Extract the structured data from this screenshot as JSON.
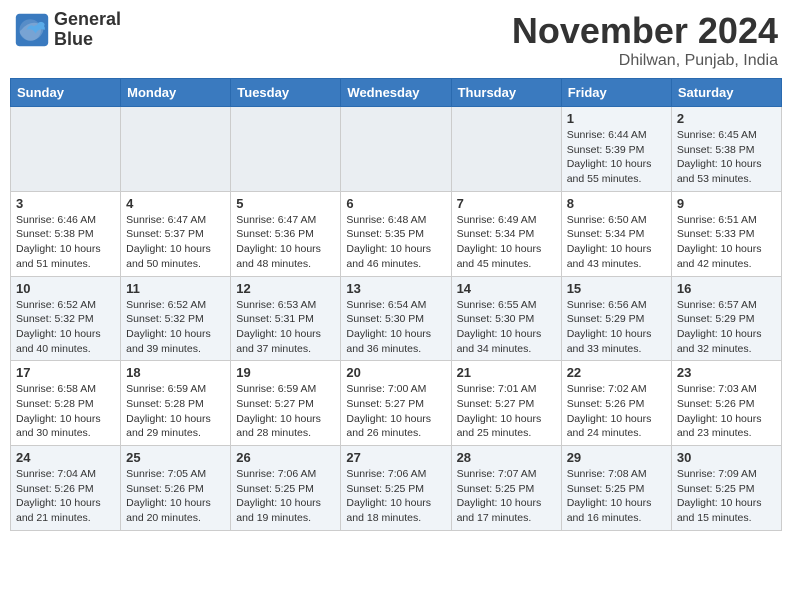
{
  "header": {
    "logo_line1": "General",
    "logo_line2": "Blue",
    "month_title": "November 2024",
    "location": "Dhilwan, Punjab, India"
  },
  "weekdays": [
    "Sunday",
    "Monday",
    "Tuesday",
    "Wednesday",
    "Thursday",
    "Friday",
    "Saturday"
  ],
  "weeks": [
    [
      {
        "day": "",
        "info": ""
      },
      {
        "day": "",
        "info": ""
      },
      {
        "day": "",
        "info": ""
      },
      {
        "day": "",
        "info": ""
      },
      {
        "day": "",
        "info": ""
      },
      {
        "day": "1",
        "info": "Sunrise: 6:44 AM\nSunset: 5:39 PM\nDaylight: 10 hours\nand 55 minutes."
      },
      {
        "day": "2",
        "info": "Sunrise: 6:45 AM\nSunset: 5:38 PM\nDaylight: 10 hours\nand 53 minutes."
      }
    ],
    [
      {
        "day": "3",
        "info": "Sunrise: 6:46 AM\nSunset: 5:38 PM\nDaylight: 10 hours\nand 51 minutes."
      },
      {
        "day": "4",
        "info": "Sunrise: 6:47 AM\nSunset: 5:37 PM\nDaylight: 10 hours\nand 50 minutes."
      },
      {
        "day": "5",
        "info": "Sunrise: 6:47 AM\nSunset: 5:36 PM\nDaylight: 10 hours\nand 48 minutes."
      },
      {
        "day": "6",
        "info": "Sunrise: 6:48 AM\nSunset: 5:35 PM\nDaylight: 10 hours\nand 46 minutes."
      },
      {
        "day": "7",
        "info": "Sunrise: 6:49 AM\nSunset: 5:34 PM\nDaylight: 10 hours\nand 45 minutes."
      },
      {
        "day": "8",
        "info": "Sunrise: 6:50 AM\nSunset: 5:34 PM\nDaylight: 10 hours\nand 43 minutes."
      },
      {
        "day": "9",
        "info": "Sunrise: 6:51 AM\nSunset: 5:33 PM\nDaylight: 10 hours\nand 42 minutes."
      }
    ],
    [
      {
        "day": "10",
        "info": "Sunrise: 6:52 AM\nSunset: 5:32 PM\nDaylight: 10 hours\nand 40 minutes."
      },
      {
        "day": "11",
        "info": "Sunrise: 6:52 AM\nSunset: 5:32 PM\nDaylight: 10 hours\nand 39 minutes."
      },
      {
        "day": "12",
        "info": "Sunrise: 6:53 AM\nSunset: 5:31 PM\nDaylight: 10 hours\nand 37 minutes."
      },
      {
        "day": "13",
        "info": "Sunrise: 6:54 AM\nSunset: 5:30 PM\nDaylight: 10 hours\nand 36 minutes."
      },
      {
        "day": "14",
        "info": "Sunrise: 6:55 AM\nSunset: 5:30 PM\nDaylight: 10 hours\nand 34 minutes."
      },
      {
        "day": "15",
        "info": "Sunrise: 6:56 AM\nSunset: 5:29 PM\nDaylight: 10 hours\nand 33 minutes."
      },
      {
        "day": "16",
        "info": "Sunrise: 6:57 AM\nSunset: 5:29 PM\nDaylight: 10 hours\nand 32 minutes."
      }
    ],
    [
      {
        "day": "17",
        "info": "Sunrise: 6:58 AM\nSunset: 5:28 PM\nDaylight: 10 hours\nand 30 minutes."
      },
      {
        "day": "18",
        "info": "Sunrise: 6:59 AM\nSunset: 5:28 PM\nDaylight: 10 hours\nand 29 minutes."
      },
      {
        "day": "19",
        "info": "Sunrise: 6:59 AM\nSunset: 5:27 PM\nDaylight: 10 hours\nand 28 minutes."
      },
      {
        "day": "20",
        "info": "Sunrise: 7:00 AM\nSunset: 5:27 PM\nDaylight: 10 hours\nand 26 minutes."
      },
      {
        "day": "21",
        "info": "Sunrise: 7:01 AM\nSunset: 5:27 PM\nDaylight: 10 hours\nand 25 minutes."
      },
      {
        "day": "22",
        "info": "Sunrise: 7:02 AM\nSunset: 5:26 PM\nDaylight: 10 hours\nand 24 minutes."
      },
      {
        "day": "23",
        "info": "Sunrise: 7:03 AM\nSunset: 5:26 PM\nDaylight: 10 hours\nand 23 minutes."
      }
    ],
    [
      {
        "day": "24",
        "info": "Sunrise: 7:04 AM\nSunset: 5:26 PM\nDaylight: 10 hours\nand 21 minutes."
      },
      {
        "day": "25",
        "info": "Sunrise: 7:05 AM\nSunset: 5:26 PM\nDaylight: 10 hours\nand 20 minutes."
      },
      {
        "day": "26",
        "info": "Sunrise: 7:06 AM\nSunset: 5:25 PM\nDaylight: 10 hours\nand 19 minutes."
      },
      {
        "day": "27",
        "info": "Sunrise: 7:06 AM\nSunset: 5:25 PM\nDaylight: 10 hours\nand 18 minutes."
      },
      {
        "day": "28",
        "info": "Sunrise: 7:07 AM\nSunset: 5:25 PM\nDaylight: 10 hours\nand 17 minutes."
      },
      {
        "day": "29",
        "info": "Sunrise: 7:08 AM\nSunset: 5:25 PM\nDaylight: 10 hours\nand 16 minutes."
      },
      {
        "day": "30",
        "info": "Sunrise: 7:09 AM\nSunset: 5:25 PM\nDaylight: 10 hours\nand 15 minutes."
      }
    ]
  ]
}
